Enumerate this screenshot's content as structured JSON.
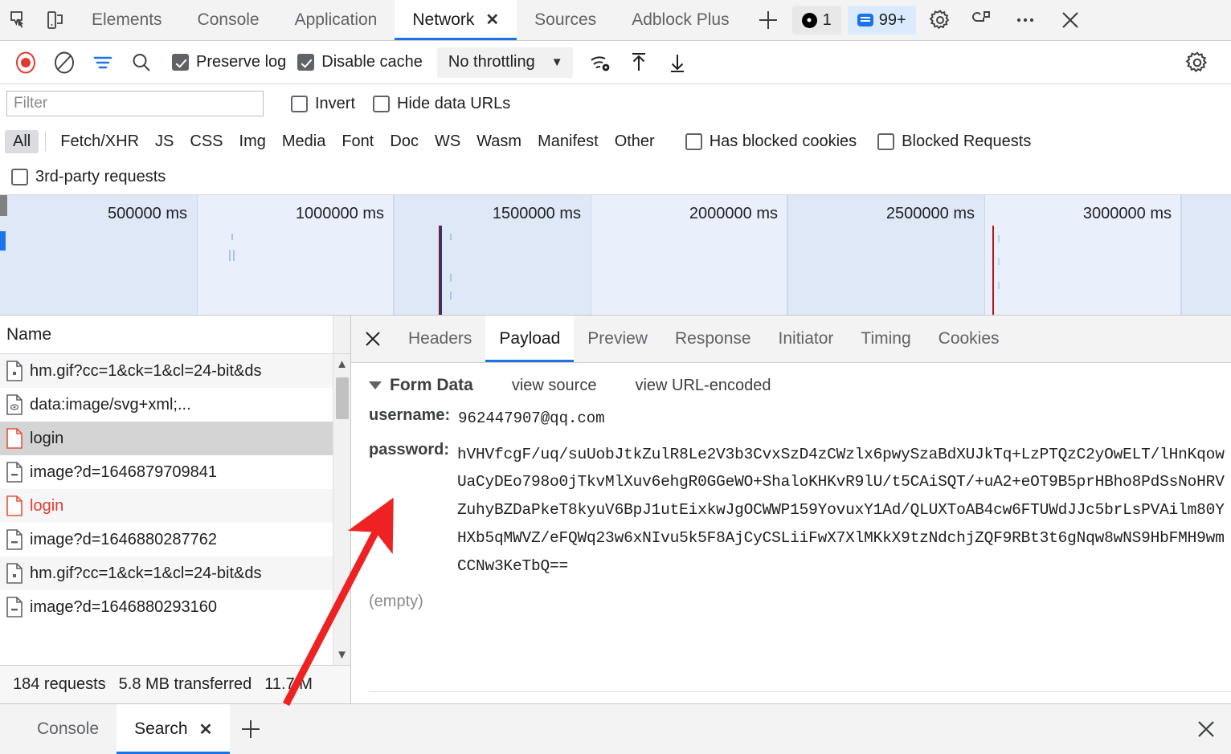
{
  "devtools_tabs": {
    "left_icons": [
      "inspect-icon",
      "device-toolbar-icon"
    ],
    "items": [
      {
        "label": "Elements",
        "active": false,
        "closable": false
      },
      {
        "label": "Console",
        "active": false,
        "closable": false
      },
      {
        "label": "Application",
        "active": false,
        "closable": false
      },
      {
        "label": "Network",
        "active": true,
        "closable": true
      },
      {
        "label": "Sources",
        "active": false,
        "closable": false
      },
      {
        "label": "Adblock Plus",
        "active": false,
        "closable": false
      }
    ],
    "add_tab_label": "+",
    "error_badge": "1",
    "message_badge": "99+",
    "right_icons": [
      "gear-icon",
      "customize-icon",
      "more-options-icon",
      "close-icon"
    ]
  },
  "network_toolbar": {
    "record_title": "record-button",
    "clear_title": "clear-button",
    "filter_title": "filter-button",
    "search_title": "search-button",
    "preserve_log": {
      "label": "Preserve log",
      "checked": true
    },
    "disable_cache": {
      "label": "Disable cache",
      "checked": true
    },
    "throttling": {
      "value": "No throttling",
      "caret": "▼"
    },
    "right_icons": [
      "network-conditions-icon",
      "import-har-icon",
      "export-har-icon",
      "network-settings-icon"
    ]
  },
  "filter_bar": {
    "filter_placeholder": "Filter",
    "filter_value": "",
    "invert": {
      "label": "Invert",
      "checked": false
    },
    "hide_data_urls": {
      "label": "Hide data URLs",
      "checked": false
    }
  },
  "type_filters": {
    "items": [
      {
        "label": "All",
        "active": true
      },
      {
        "label": "Fetch/XHR",
        "active": false
      },
      {
        "label": "JS",
        "active": false
      },
      {
        "label": "CSS",
        "active": false
      },
      {
        "label": "Img",
        "active": false
      },
      {
        "label": "Media",
        "active": false
      },
      {
        "label": "Font",
        "active": false
      },
      {
        "label": "Doc",
        "active": false
      },
      {
        "label": "WS",
        "active": false
      },
      {
        "label": "Wasm",
        "active": false
      },
      {
        "label": "Manifest",
        "active": false
      },
      {
        "label": "Other",
        "active": false
      }
    ],
    "has_blocked_cookies": {
      "label": "Has blocked cookies",
      "checked": false
    },
    "blocked_requests": {
      "label": "Blocked Requests",
      "checked": false
    },
    "third_party": {
      "label": "3rd-party requests",
      "checked": false
    }
  },
  "overview": {
    "ticks": [
      "500000 ms",
      "1000000 ms",
      "1500000 ms",
      "2000000 ms",
      "2500000 ms",
      "3000000 ms"
    ],
    "event_markers": [
      {
        "position_pct": 35.7,
        "color": "#8b1a1a"
      },
      {
        "position_pct": 35.9,
        "color": "#1a3a8b"
      },
      {
        "position_pct": 80.4,
        "color": "#b3131d"
      }
    ]
  },
  "request_list": {
    "column_header": "Name",
    "rows": [
      {
        "name": "hm.gif?cc=1&ck=1&cl=24-bit&ds",
        "icon": "document-icon",
        "error": false,
        "selected": false
      },
      {
        "name": "data:image/svg+xml;...",
        "icon": "image-icon",
        "error": false,
        "selected": false
      },
      {
        "name": "login",
        "icon": "document-icon",
        "error": true,
        "selected": true
      },
      {
        "name": "image?d=1646879709841",
        "icon": "document-icon",
        "error": false,
        "selected": false
      },
      {
        "name": "login",
        "icon": "document-icon",
        "error": true,
        "selected": false
      },
      {
        "name": "image?d=1646880287762",
        "icon": "document-icon",
        "error": false,
        "selected": false
      },
      {
        "name": "hm.gif?cc=1&ck=1&cl=24-bit&ds",
        "icon": "document-icon",
        "error": false,
        "selected": false
      },
      {
        "name": "image?d=1646880293160",
        "icon": "document-icon",
        "error": false,
        "selected": false
      }
    ],
    "status": {
      "requests": "184 requests",
      "transferred": "5.8 MB transferred",
      "resources": "11.7 M"
    }
  },
  "detail_panel": {
    "close_icon": "✕",
    "tabs": [
      {
        "label": "Headers",
        "active": false
      },
      {
        "label": "Payload",
        "active": true
      },
      {
        "label": "Preview",
        "active": false
      },
      {
        "label": "Response",
        "active": false
      },
      {
        "label": "Initiator",
        "active": false
      },
      {
        "label": "Timing",
        "active": false
      },
      {
        "label": "Cookies",
        "active": false
      }
    ],
    "form_data": {
      "section_title": "Form Data",
      "view_source_label": "view source",
      "view_url_encoded_label": "view URL-encoded",
      "username_key": "username:",
      "username_value": "962447907@qq.com",
      "password_key": "password:",
      "password_value": "hVHVfcgF/uq/suUobJtkZulR8Le2V3b3CvxSzD4zCWzlx6pwySzaBdXUJkTq+LzPTQzC2yOwELT/lHnKqowUaCyDEo798o0jTkvMlXuv6ehgR0GGeWO+ShaloKHKvR9lU/t5CAiSQT/+uA2+eOT9B5prHBho8PdSsNoHRVZuhyBZDaPkeT8kyuV6BpJ1utEixkwJgOCWWP159YovuxY1Ad/QLUXToAB4cw6FTUWdJJc5brLsPVAilm80YHXb5qMWVZ/eFQWq23w6xNIvu5k5F8AjCyCSLiiFwX7XlMKkX9tzNdchjZQF9RBt3t6gNqw8wNS9HbFMH9wmCCNw3KeTbQ==",
      "empty_label": "(empty)"
    }
  },
  "drawer": {
    "tabs": [
      {
        "label": "Console",
        "active": false,
        "closable": false
      },
      {
        "label": "Search",
        "active": true,
        "closable": true
      }
    ],
    "add_label": "+",
    "close_icon": "✕"
  },
  "colors": {
    "accent": "#1a73e8",
    "error_red": "#e03b2f",
    "annotation_red": "#ee2222",
    "overview_bg": "#dfe8f7"
  }
}
